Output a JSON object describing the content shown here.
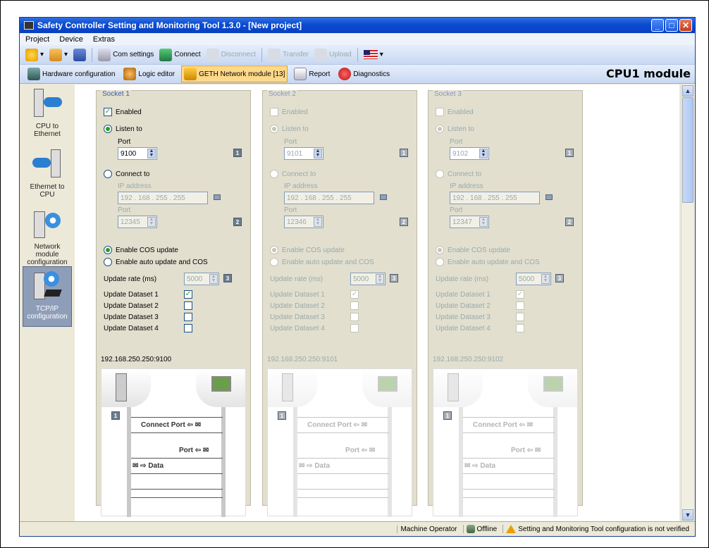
{
  "window": {
    "title": "Safety Controller Setting and Monitoring Tool 1.3.0 - [New project]"
  },
  "menu": [
    "Project",
    "Device",
    "Extras"
  ],
  "toolbar1": {
    "com_settings": "Com settings",
    "connect": "Connect",
    "disconnect": "Disconnect",
    "transfer": "Transfer",
    "upload": "Upload"
  },
  "toolbar2": {
    "hardware": "Hardware configuration",
    "logic": "Logic editor",
    "geth": "GETH Network module [13]",
    "report": "Report",
    "diagnostics": "Diagnostics"
  },
  "module_title": "CPU1 module",
  "sidebar": [
    {
      "label": "CPU to Ethernet"
    },
    {
      "label": "Ethernet to CPU"
    },
    {
      "label": "Network module configuration"
    },
    {
      "label": "TCP/IP configuration"
    }
  ],
  "common": {
    "enabled": "Enabled",
    "listen_to": "Listen to",
    "port": "Port",
    "connect_to": "Connect to",
    "ip_address": "IP address",
    "cos": "Enable COS update",
    "auto": "Enable auto update and COS",
    "update_rate": "Update rate (ms)",
    "ds1": "Update Dataset 1",
    "ds2": "Update Dataset 2",
    "ds3": "Update Dataset 3",
    "ds4": "Update Dataset 4",
    "connect_port": "Connect Port",
    "port_msg": "Port",
    "data": "Data",
    "n1": "1",
    "n2": "2",
    "n3": "3"
  },
  "sockets": [
    {
      "title": "Socket 1",
      "listen_port": "9100",
      "ip": " 192 . 168 . 255 . 255",
      "connect_port": "12345",
      "rate": "5000",
      "endpoint": "192.168.250.250:9100"
    },
    {
      "title": "Socket 2",
      "listen_port": "9101",
      "ip": " 192 . 168 . 255 . 255",
      "connect_port": "12346",
      "rate": "5000",
      "endpoint": "192.168.250.250:9101"
    },
    {
      "title": "Socket 3",
      "listen_port": "9102",
      "ip": " 192 . 168 . 255 . 255",
      "connect_port": "12347",
      "rate": "5000",
      "endpoint": "192.168.250.250:9102"
    }
  ],
  "status": {
    "user": "Machine Operator",
    "mode": "Offline",
    "warning": "Setting and Monitoring Tool configuration is not verified"
  },
  "colors": {
    "title_bar": "#0a4bd1",
    "active_tab": "#ffd98a",
    "check_green": "#21a121"
  }
}
